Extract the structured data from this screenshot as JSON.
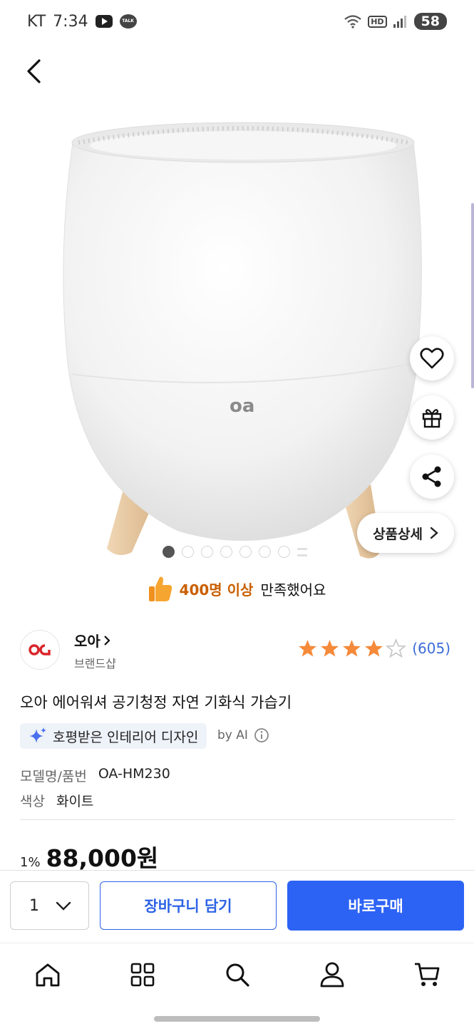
{
  "status_bar": {
    "carrier": "KT",
    "time": "7:34",
    "talk_text": "TALK",
    "hd_text": "HD",
    "battery": "58"
  },
  "hero": {
    "detail_pill_label": "상품상세",
    "image_count": 8,
    "active_image_index": 0
  },
  "satisfaction": {
    "strong": "400명 이상",
    "rest": "만족했어요"
  },
  "brand": {
    "name": "오아",
    "subtitle": "브랜드샵",
    "rating": 4,
    "review_count": "(605)"
  },
  "product": {
    "title": "오아 에어워셔 공기청정 자연 기화식 가습기",
    "ai_badge": "호평받은 인테리어 디자인",
    "by_ai": "by AI",
    "specs": [
      {
        "label": "모델명/품번",
        "value": "OA-HM230"
      },
      {
        "label": "색상",
        "value": "화이트"
      }
    ],
    "discount": "1%",
    "price": "88,000원"
  },
  "purchase": {
    "quantity": "1",
    "cart_label": "장바구니 담기",
    "buy_label": "바로구매"
  },
  "colors": {
    "primary_blue": "#2d63f5",
    "star": "#f58a3a",
    "highlight_orange": "#c95f00",
    "review_blue": "#3c6cd8"
  },
  "icons": {
    "nav": [
      "home-icon",
      "category-grid-icon",
      "search-icon",
      "my-page-icon",
      "cart-icon"
    ],
    "side": [
      "heart-icon",
      "gift-icon",
      "share-icon"
    ]
  }
}
